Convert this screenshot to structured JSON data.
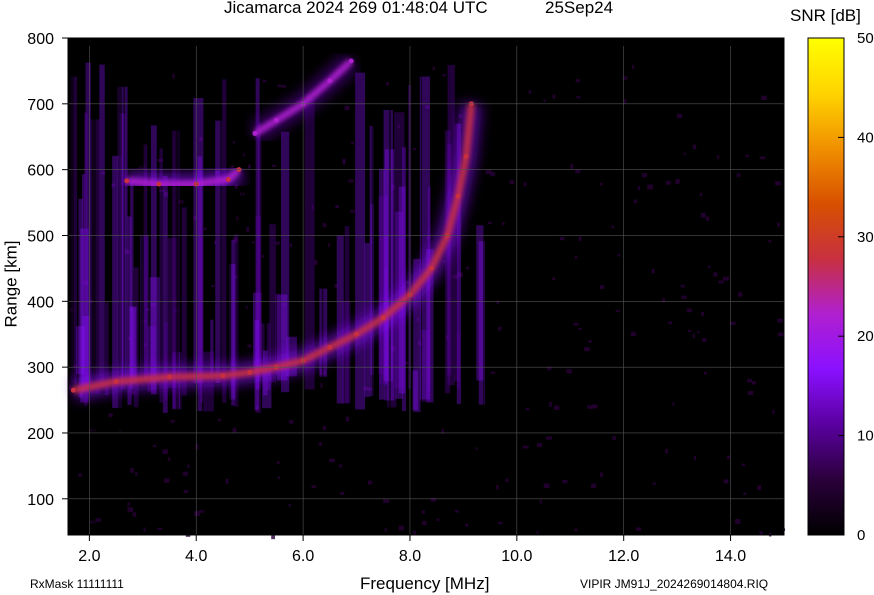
{
  "header": {
    "title": "Jicamarca 2024 269 01:48:04 UTC",
    "date": "25Sep24",
    "colorbar_label": "SNR [dB]"
  },
  "footer": {
    "rxmask": "RxMask 11111111",
    "filename": "VIPIR  JM91J_2024269014804.RIQ"
  },
  "colorbar": {
    "ticks": [
      "0",
      "10",
      "20",
      "30",
      "40",
      "50"
    ],
    "range": [
      0,
      50
    ],
    "colors": [
      "#000000",
      "#2a003a",
      "#5a00a0",
      "#8a10ff",
      "#b020d0",
      "#c83040",
      "#d85000",
      "#f09000",
      "#ffd400",
      "#ffff00"
    ]
  },
  "chart_data": {
    "type": "heatmap",
    "title": "Jicamarca 2024 269 01:48:04 UTC",
    "xlabel": "Frequency [MHz]",
    "ylabel": "Range [km]",
    "xlim": [
      1.6,
      15.0
    ],
    "ylim": [
      45,
      800
    ],
    "x_tick_labels": [
      "2.0",
      "4.0",
      "6.0",
      "8.0",
      "10.0",
      "12.0",
      "14.0"
    ],
    "y_tick_labels": [
      "100",
      "200",
      "300",
      "400",
      "500",
      "600",
      "700",
      "800"
    ],
    "grid": true,
    "colorbar": {
      "label": "SNR [dB]",
      "range": [
        0,
        50
      ]
    },
    "traces": [
      {
        "name": "",
        "points": [
          [
            1.7,
            265
          ],
          [
            2.5,
            278
          ],
          [
            3.5,
            285
          ],
          [
            4.5,
            287
          ],
          [
            5.0,
            292
          ],
          [
            5.5,
            300
          ],
          [
            6.0,
            310
          ],
          [
            6.5,
            330
          ],
          [
            7.0,
            350
          ],
          [
            7.5,
            375
          ],
          [
            8.0,
            410
          ],
          [
            8.4,
            450
          ],
          [
            8.7,
            500
          ],
          [
            8.9,
            560
          ],
          [
            9.05,
            620
          ],
          [
            9.15,
            700
          ]
        ],
        "snr": 28
      },
      {
        "name": "",
        "points": [
          [
            2.7,
            583
          ],
          [
            3.3,
            578
          ],
          [
            4.0,
            578
          ],
          [
            4.6,
            585
          ],
          [
            4.8,
            600
          ]
        ],
        "snr": 24
      },
      {
        "name": "",
        "points": [
          [
            5.1,
            655
          ],
          [
            5.5,
            675
          ],
          [
            6.0,
            700
          ],
          [
            6.5,
            735
          ],
          [
            6.9,
            765
          ]
        ],
        "snr": 22
      }
    ]
  }
}
